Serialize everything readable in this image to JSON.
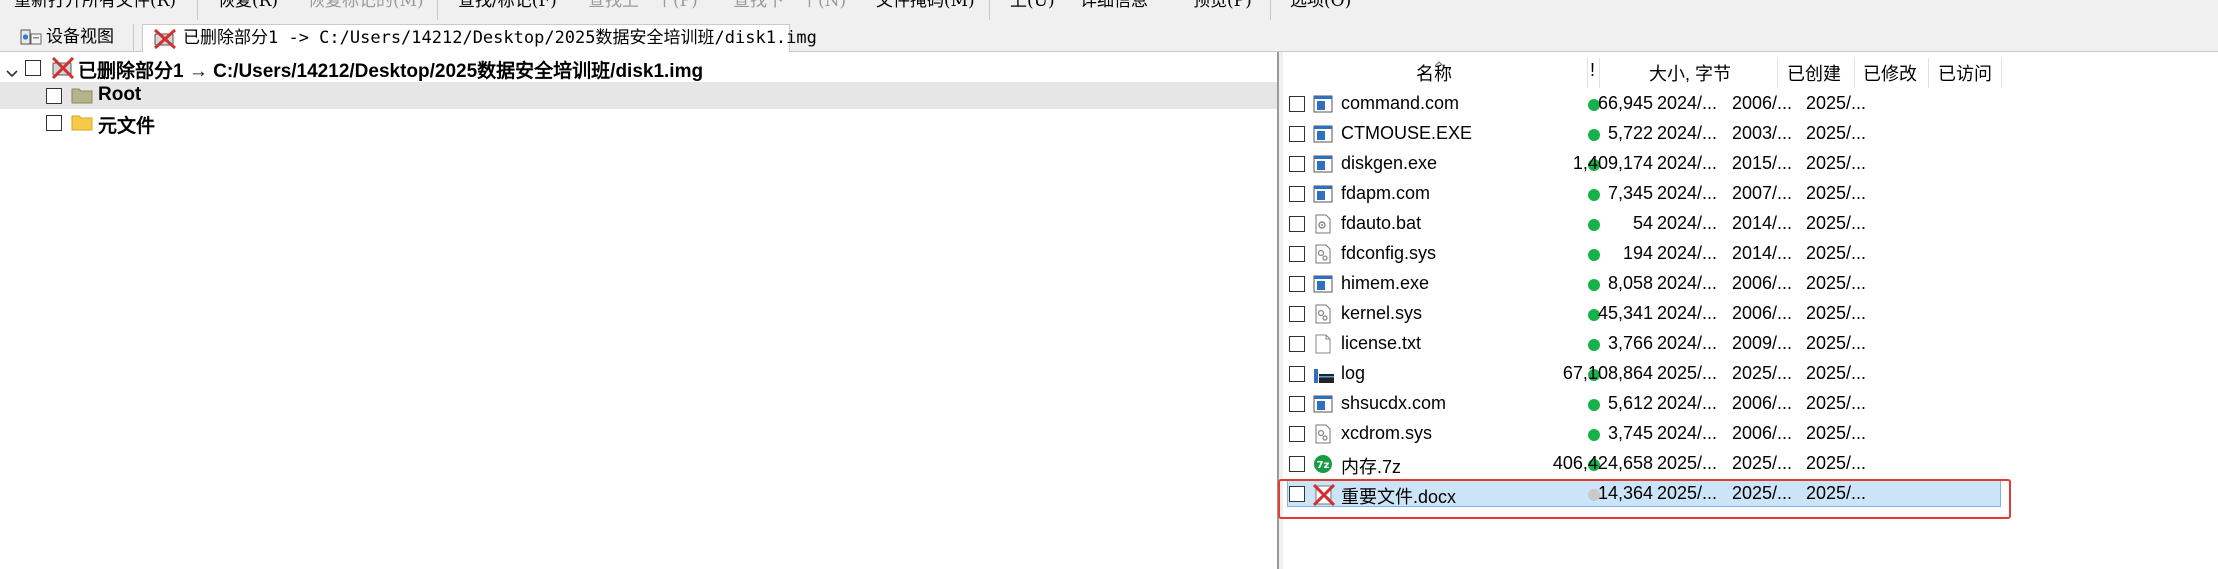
{
  "menu": {
    "items": [
      {
        "label": "重新打开所有文件(R)",
        "disabled": false
      },
      {
        "label": "恢复(R)",
        "disabled": false
      },
      {
        "label": "恢复标记的(M)",
        "disabled": true
      },
      {
        "label": "查找/标记(F)",
        "disabled": false
      },
      {
        "label": "查找上一个(P)",
        "disabled": true
      },
      {
        "label": "查找下一个(N)",
        "disabled": true
      },
      {
        "label": "文件掩码(M)",
        "disabled": false
      },
      {
        "label": "上(U)",
        "disabled": false
      },
      {
        "label": "详细信息",
        "disabled": false
      },
      {
        "label": "预览(P)",
        "disabled": false
      },
      {
        "label": "选项(O)",
        "disabled": false
      }
    ]
  },
  "tabs": {
    "device": {
      "label": "设备视图",
      "icon": "device-view-icon"
    },
    "partition": {
      "label": "已删除部分1 -> C:/Users/14212/Desktop/2025数据安全培训班/disk1.img",
      "icon": "deleted-partition-icon"
    }
  },
  "tree": {
    "root_label": "已删除部分1 → C:/Users/14212/Desktop/2025数据安全培训班/disk1.img",
    "children": [
      {
        "label": "Root",
        "icon": "folder-icon",
        "selected": true
      },
      {
        "label": "元文件",
        "icon": "folder-icon",
        "selected": false
      }
    ]
  },
  "list": {
    "columns": {
      "name": "名称",
      "flag": "!",
      "size": "大小, 字节",
      "created": "已创建",
      "modified": "已修改",
      "accessed": "已访问"
    },
    "rows": [
      {
        "name": "command.com",
        "icon": "executable-icon",
        "status": "green",
        "size": "66,945",
        "created": "2024/...",
        "modified": "2006/...",
        "accessed": "2025/..."
      },
      {
        "name": "CTMOUSE.EXE",
        "icon": "executable-icon",
        "status": "green",
        "size": "5,722",
        "created": "2024/...",
        "modified": "2003/...",
        "accessed": "2025/..."
      },
      {
        "name": "diskgen.exe",
        "icon": "executable-icon",
        "status": "green",
        "size": "1,409,174",
        "created": "2024/...",
        "modified": "2015/...",
        "accessed": "2025/..."
      },
      {
        "name": "fdapm.com",
        "icon": "executable-icon",
        "status": "green",
        "size": "7,345",
        "created": "2024/...",
        "modified": "2007/...",
        "accessed": "2025/..."
      },
      {
        "name": "fdauto.bat",
        "icon": "batch-file-icon",
        "status": "green",
        "size": "54",
        "created": "2024/...",
        "modified": "2014/...",
        "accessed": "2025/..."
      },
      {
        "name": "fdconfig.sys",
        "icon": "system-file-icon",
        "status": "green",
        "size": "194",
        "created": "2024/...",
        "modified": "2014/...",
        "accessed": "2025/..."
      },
      {
        "name": "himem.exe",
        "icon": "executable-icon",
        "status": "green",
        "size": "8,058",
        "created": "2024/...",
        "modified": "2006/...",
        "accessed": "2025/..."
      },
      {
        "name": "kernel.sys",
        "icon": "system-file-icon",
        "status": "green",
        "size": "45,341",
        "created": "2024/...",
        "modified": "2006/...",
        "accessed": "2025/..."
      },
      {
        "name": "license.txt",
        "icon": "text-file-icon",
        "status": "green",
        "size": "3,766",
        "created": "2024/...",
        "modified": "2009/...",
        "accessed": "2025/..."
      },
      {
        "name": "log",
        "icon": "log-file-icon",
        "status": "green",
        "size": "67,108,864",
        "created": "2025/...",
        "modified": "2025/...",
        "accessed": "2025/..."
      },
      {
        "name": "shsucdx.com",
        "icon": "executable-icon",
        "status": "green",
        "size": "5,612",
        "created": "2024/...",
        "modified": "2006/...",
        "accessed": "2025/..."
      },
      {
        "name": "xcdrom.sys",
        "icon": "system-file-icon",
        "status": "green",
        "size": "3,745",
        "created": "2024/...",
        "modified": "2006/...",
        "accessed": "2025/..."
      },
      {
        "name": "内存.7z",
        "icon": "archive-7z-icon",
        "status": "green",
        "size": "406,424,658",
        "created": "2025/...",
        "modified": "2025/...",
        "accessed": "2025/..."
      },
      {
        "name": "重要文件.docx",
        "icon": "deleted-file-icon",
        "status": "gray",
        "size": "14,364",
        "created": "2025/...",
        "modified": "2025/...",
        "accessed": "2025/...",
        "highlighted": true
      }
    ]
  },
  "colors": {
    "status_green": "#17b14a",
    "status_gray": "#c9c9c9",
    "selection_fill": "#cce4f7",
    "selection_border": "#7fb4e6",
    "annotation_red": "#e53935",
    "folder_yellow": "#f7c948",
    "folder_olive": "#b4b48a"
  }
}
